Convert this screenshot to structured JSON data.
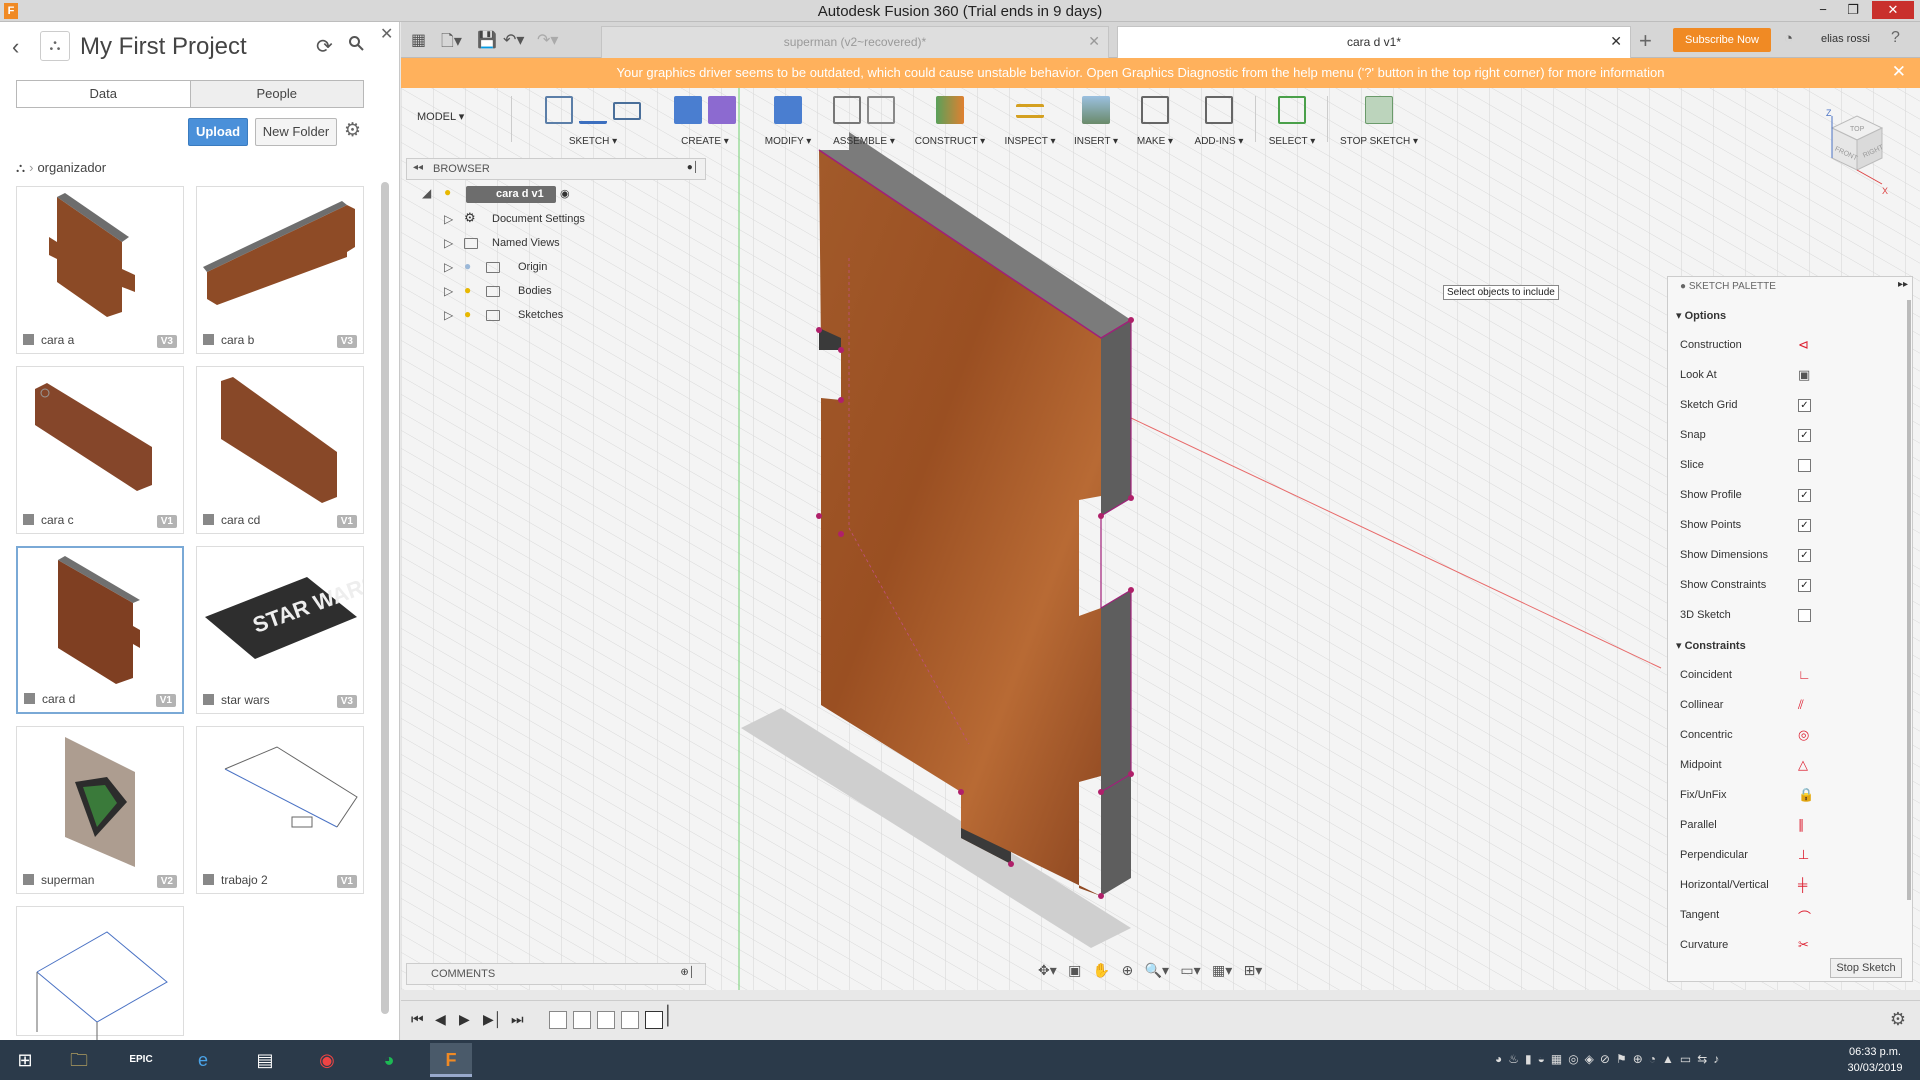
{
  "window": {
    "title": "Autodesk Fusion 360 (Trial ends in 9 days)",
    "app_icon": "F",
    "min": "−",
    "max": "❐",
    "close": "✕"
  },
  "data_panel": {
    "project_title": "My First Project",
    "tabs": [
      "Data",
      "People"
    ],
    "upload_label": "Upload",
    "new_folder_label": "New Folder",
    "breadcrumb": "organizador",
    "items": [
      {
        "name": "cara a",
        "version": "V3"
      },
      {
        "name": "cara b",
        "version": "V3"
      },
      {
        "name": "cara c",
        "version": "V1"
      },
      {
        "name": "cara cd",
        "version": "V1"
      },
      {
        "name": "cara d",
        "version": "V1"
      },
      {
        "name": "star wars",
        "version": "V3"
      },
      {
        "name": "superman",
        "version": "V2"
      },
      {
        "name": "trabajo 2",
        "version": "V1"
      },
      {
        "name": "",
        "version": ""
      }
    ],
    "star_wars_art_text": "STAR WARS"
  },
  "doc_tabs": [
    {
      "label": "superman (v2~recovered)*",
      "active": false
    },
    {
      "label": "cara d v1*",
      "active": true
    }
  ],
  "header_right": {
    "subscribe_label": "Subscribe Now",
    "user_name": "elias rossi"
  },
  "warning": {
    "message": "Your graphics driver seems to be outdated, which could cause unstable behavior. Open Graphics Diagnostic from the help menu ('?' button in the top right corner) for more information"
  },
  "toolbar": {
    "workspace": "MODEL",
    "groups": [
      "SKETCH",
      "CREATE",
      "MODIFY",
      "ASSEMBLE",
      "CONSTRUCT",
      "INSPECT",
      "INSERT",
      "MAKE",
      "ADD-INS",
      "SELECT",
      "STOP SKETCH"
    ]
  },
  "browser": {
    "header": "BROWSER",
    "root": "cara d v1",
    "nodes": [
      "Document Settings",
      "Named Views",
      "Origin",
      "Bodies",
      "Sketches"
    ]
  },
  "viewport": {
    "tooltip": "Select objects to include"
  },
  "viewcube": {
    "top": "TOP",
    "front": "FRONT",
    "right": "RIGHT",
    "axis_z": "Z",
    "axis_x": "X"
  },
  "palette": {
    "title": "SKETCH PALETTE",
    "options_header": "Options",
    "options": [
      {
        "label": "Construction",
        "icon": "construction-icon"
      },
      {
        "label": "Look At",
        "icon": "look-at-icon"
      },
      {
        "label": "Sketch Grid",
        "checked": true
      },
      {
        "label": "Snap",
        "checked": true
      },
      {
        "label": "Slice",
        "checked": false
      },
      {
        "label": "Show Profile",
        "checked": true
      },
      {
        "label": "Show Points",
        "checked": true
      },
      {
        "label": "Show Dimensions",
        "checked": true
      },
      {
        "label": "Show Constraints",
        "checked": true
      },
      {
        "label": "3D Sketch",
        "checked": false
      }
    ],
    "constraints_header": "Constraints",
    "constraints": [
      {
        "label": "Coincident",
        "icon": "coincident-icon"
      },
      {
        "label": "Collinear",
        "icon": "collinear-icon"
      },
      {
        "label": "Concentric",
        "icon": "concentric-icon"
      },
      {
        "label": "Midpoint",
        "icon": "midpoint-icon"
      },
      {
        "label": "Fix/UnFix",
        "icon": "lock-icon"
      },
      {
        "label": "Parallel",
        "icon": "parallel-icon"
      },
      {
        "label": "Perpendicular",
        "icon": "perpendicular-icon"
      },
      {
        "label": "Horizontal/Vertical",
        "icon": "horizontal-vertical-icon"
      },
      {
        "label": "Tangent",
        "icon": "tangent-icon"
      },
      {
        "label": "Curvature",
        "icon": "curvature-icon"
      }
    ],
    "stop_sketch_label": "Stop Sketch"
  },
  "comments": {
    "label": "COMMENTS"
  },
  "taskbar": {
    "time": "06:33 p.m.",
    "date": "30/03/2019"
  },
  "colors": {
    "accent_orange": "#f08a24",
    "warning_bg": "#ffb15c",
    "upload_blue": "#4a90d9",
    "wood": "#a05a2c",
    "sketch_magenta": "#a0207a"
  }
}
